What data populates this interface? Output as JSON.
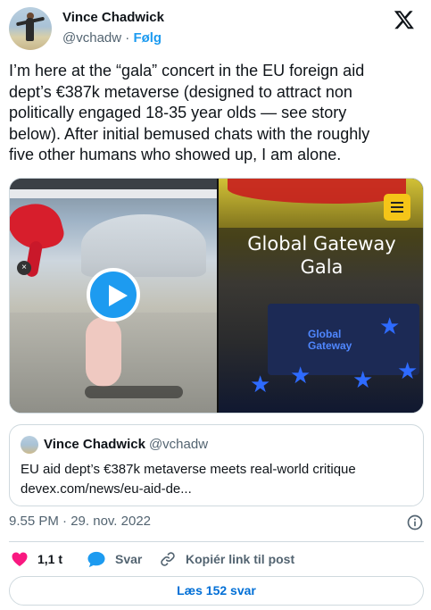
{
  "author": {
    "name": "Vince Chadwick",
    "handle": "@vchadw",
    "separator": "·",
    "follow_label": "Følg"
  },
  "tweet": {
    "lines": [
      "I’m here at the “gala” concert in the EU foreign aid",
      "dept’s €387k metaverse (designed to attract non",
      "politically engaged 18-35 year olds — see story",
      "below). After initial bemused chats with the roughly",
      "five other humans who showed up, I am alone."
    ]
  },
  "media": {
    "right_title_line1": "Global Gateway",
    "right_title_line2": "Gala",
    "logo_line1": "Global",
    "logo_line2": "Gateway",
    "close_glyph": "×"
  },
  "quote": {
    "name": "Vince Chadwick",
    "handle": "@vchadw",
    "text": "EU aid dept’s €387k metaverse meets real-world critique",
    "link": "devex.com/news/eu-aid-de..."
  },
  "meta": {
    "time": "9.55 PM",
    "separator": "·",
    "date": "29. nov. 2022"
  },
  "actions": {
    "likes": "1,1 t",
    "reply_label": "Svar",
    "copy_link_label": "Kopiér link til post"
  },
  "read_replies_label": "Læs 152 svar",
  "colors": {
    "accent": "#1d9bf0",
    "like": "#f91880",
    "text": "#0f1419",
    "muted": "#536471",
    "border": "#cfd9de"
  },
  "icons": [
    "x-logo-icon",
    "play-icon",
    "menu-icon",
    "info-icon",
    "heart-icon",
    "reply-bubble-icon",
    "link-icon"
  ]
}
